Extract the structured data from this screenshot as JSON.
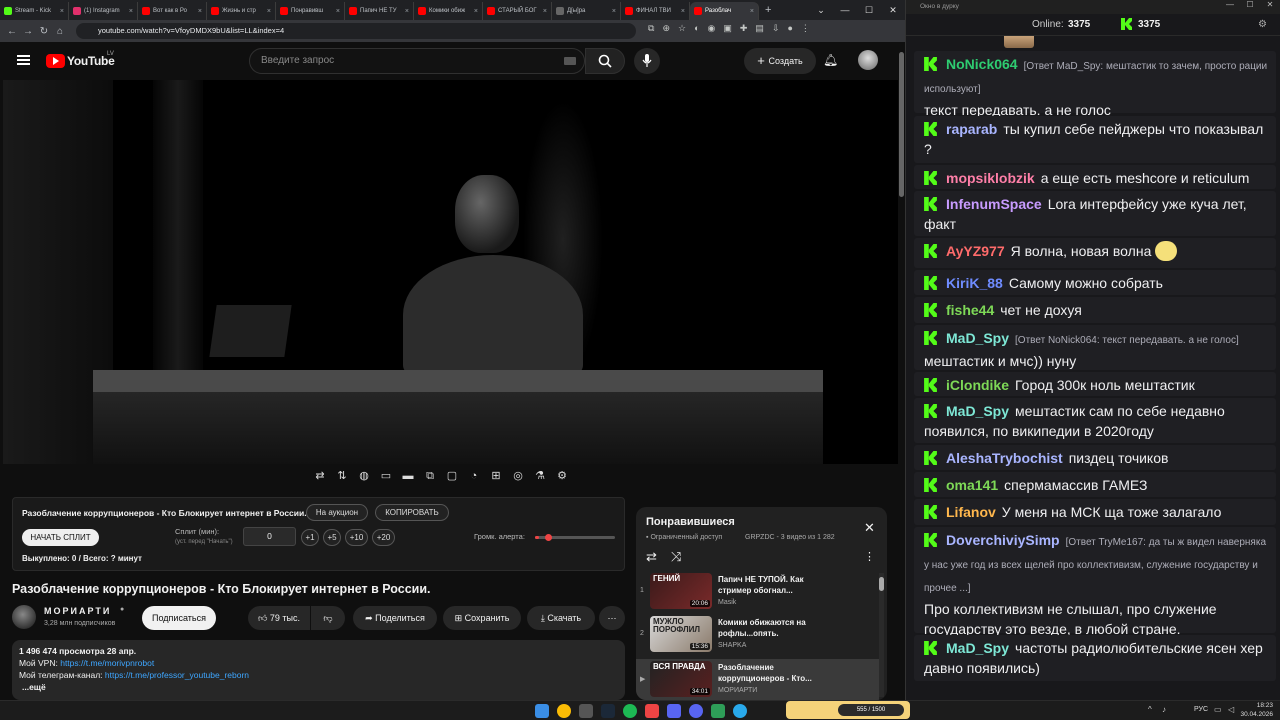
{
  "browser": {
    "tabs": [
      {
        "label": "Stream - Kick",
        "color": "#53fc18"
      },
      {
        "label": "(1) Instagram",
        "color": "#e1306c"
      },
      {
        "label": "Вот как в Ро",
        "color": "#ff0000"
      },
      {
        "label": "Жизнь и стр",
        "color": "#ff0000"
      },
      {
        "label": "Понравивш",
        "color": "#ff0000"
      },
      {
        "label": "Папич НЕ ТУ",
        "color": "#ff0000"
      },
      {
        "label": "Комики обиж",
        "color": "#ff0000"
      },
      {
        "label": "СТАРЫЙ БОГ",
        "color": "#ff0000"
      },
      {
        "label": "Д[ы]ра",
        "color": "#666666"
      },
      {
        "label": "ФИНАЛ ТВИ",
        "color": "#ff0000"
      },
      {
        "label": "Разоблач",
        "color": "#ff0000",
        "active": true
      }
    ],
    "url": "youtube.com/watch?v=VfoyDMDX9bU&list=LL&index=4"
  },
  "yt": {
    "logo": "YouTube",
    "region": "LV",
    "search_placeholder": "Введите запрос",
    "create_label": "Создать"
  },
  "split": {
    "title": "Разоблачение коррупционеров - Кто Блокирует интернет в России.",
    "auction_btn": "На аукцион",
    "copy_btn": "КОПИРОВАТЬ",
    "start_btn": "НАЧАТЬ СПЛИТ",
    "split_label": "Сплит (мин):",
    "split_hint": "(уст. перед \"Начать\")",
    "split_value": "0",
    "inc": [
      "+1",
      "+5",
      "+10",
      "+20"
    ],
    "volume_label": "Громк. алерта:",
    "volume_level": 0.05,
    "bought": "Выкуплено: 0 / Всего: ? минут"
  },
  "video": {
    "title": "Разоблачение коррупционеров - Кто Блокирует интернет в России.",
    "channel": "МОРИАРТИ",
    "subs": "3,28 млн подписчиков",
    "subscribe": "Подписаться",
    "likes": "79 тыс.",
    "share": "Поделиться",
    "save": "Сохранить",
    "download": "Скачать",
    "views_date": "1 496 474 просмотра  28 апр.",
    "vpn_label": "Мой VPN: ",
    "vpn_link": "https://t.me/morivpnrobot",
    "tg_label": "Мой телеграм-канал: ",
    "tg_link": "https://t.me/professor_youtube_reborn",
    "more": "...ещё"
  },
  "playlist": {
    "title": "Понравившиеся",
    "access": "Ограниченный доступ",
    "meta": "GRPZDC - 3 видео из 1 282",
    "items": [
      {
        "num": "1",
        "title": "Папич НЕ ТУПОЙ. Как стример обогнал...",
        "channel": "Masik",
        "duration": "20:06",
        "thumb_text": "ГЕНИЙ"
      },
      {
        "num": "2",
        "title": "Комики обижаются на рофлы...опять.",
        "channel": "SHAPKA",
        "duration": "15:36",
        "thumb_text": "МУЖЛО ПОРОФЛИЛ"
      },
      {
        "num": "▶",
        "title": "Разоблачение коррупционеров - Кто...",
        "channel": "МОРИАРТИ",
        "duration": "34:01",
        "thumb_text": "ВСЯ ПРАВДА"
      }
    ]
  },
  "chat": {
    "window_title": "Окно в дурку",
    "online_label": "Online:",
    "online_count": "3375",
    "kick_count": "3375",
    "messages": [
      {
        "nick": "NoNick064",
        "color": "#2ecc71",
        "reply": "[Ответ MaD_Spy: мештастик то зачем, просто рации используют]",
        "text": "текст передавать. а не голос"
      },
      {
        "nick": "raparab",
        "color": "#a9b5ff",
        "reply": "",
        "text": "ты купил себе пейджеры что показывал ?"
      },
      {
        "nick": "mopsiklobzik",
        "color": "#ff7fa8",
        "reply": "",
        "text": "а еще есть meshcore и reticulum"
      },
      {
        "nick": "InfenumSpace",
        "color": "#c89bff",
        "reply": "",
        "text": "Lora интерфейсу уже куча лет, факт"
      },
      {
        "nick": "AyYZ977",
        "color": "#ff6b6b",
        "reply": "",
        "text": "Я волна, новая волна"
      },
      {
        "nick": "KiriK_88",
        "color": "#6f8cff",
        "reply": "",
        "text": "Самому можно собрать"
      },
      {
        "nick": "fishe44",
        "color": "#7ed957",
        "reply": "",
        "text": "чет не дохуя"
      },
      {
        "nick": "MaD_Spy",
        "color": "#7ee8d6",
        "reply": "[Ответ NoNick064: текст передавать. а не голос]",
        "text": "мештастик и мчс)) нуну"
      },
      {
        "nick": "iClondike",
        "color": "#7ed957",
        "reply": "",
        "text": "Город 300к ноль мештастик"
      },
      {
        "nick": "MaD_Spy",
        "color": "#7ee8d6",
        "reply": "",
        "text": "мештастик сам по себе недавно появился, по википедии в 2020году"
      },
      {
        "nick": "AleshaTrybochist",
        "color": "#a9b5ff",
        "reply": "",
        "text": "пиздец точиков"
      },
      {
        "nick": "oma141",
        "color": "#7ed957",
        "reply": "",
        "text": "спермамассив ГАМЕЗ"
      },
      {
        "nick": "Lifanov",
        "color": "#ffb74d",
        "reply": "",
        "text": "У меня на МСК ща тоже залагало"
      },
      {
        "nick": "DoverchiviySimp",
        "color": "#a9b5ff",
        "reply": "[Ответ TryMe167: да ты ж видел наверняка у нас уже год из всех щелей про коллективизм, служение государству и прочее ...]",
        "text": "Про коллективизм не слышал, про служение государству это везде, в любой стране."
      },
      {
        "nick": "MaD_Spy",
        "color": "#7ee8d6",
        "reply": "",
        "text": "частоты радиолюбительские ясен хер давно появились)"
      }
    ]
  },
  "taskbar": {
    "lang": "РУС",
    "time": "18:23",
    "date": "30.04.2026",
    "widget": "555 / 1500"
  },
  "colors": {
    "kick_green": "#53fc18",
    "yt_red": "#ff0000"
  }
}
